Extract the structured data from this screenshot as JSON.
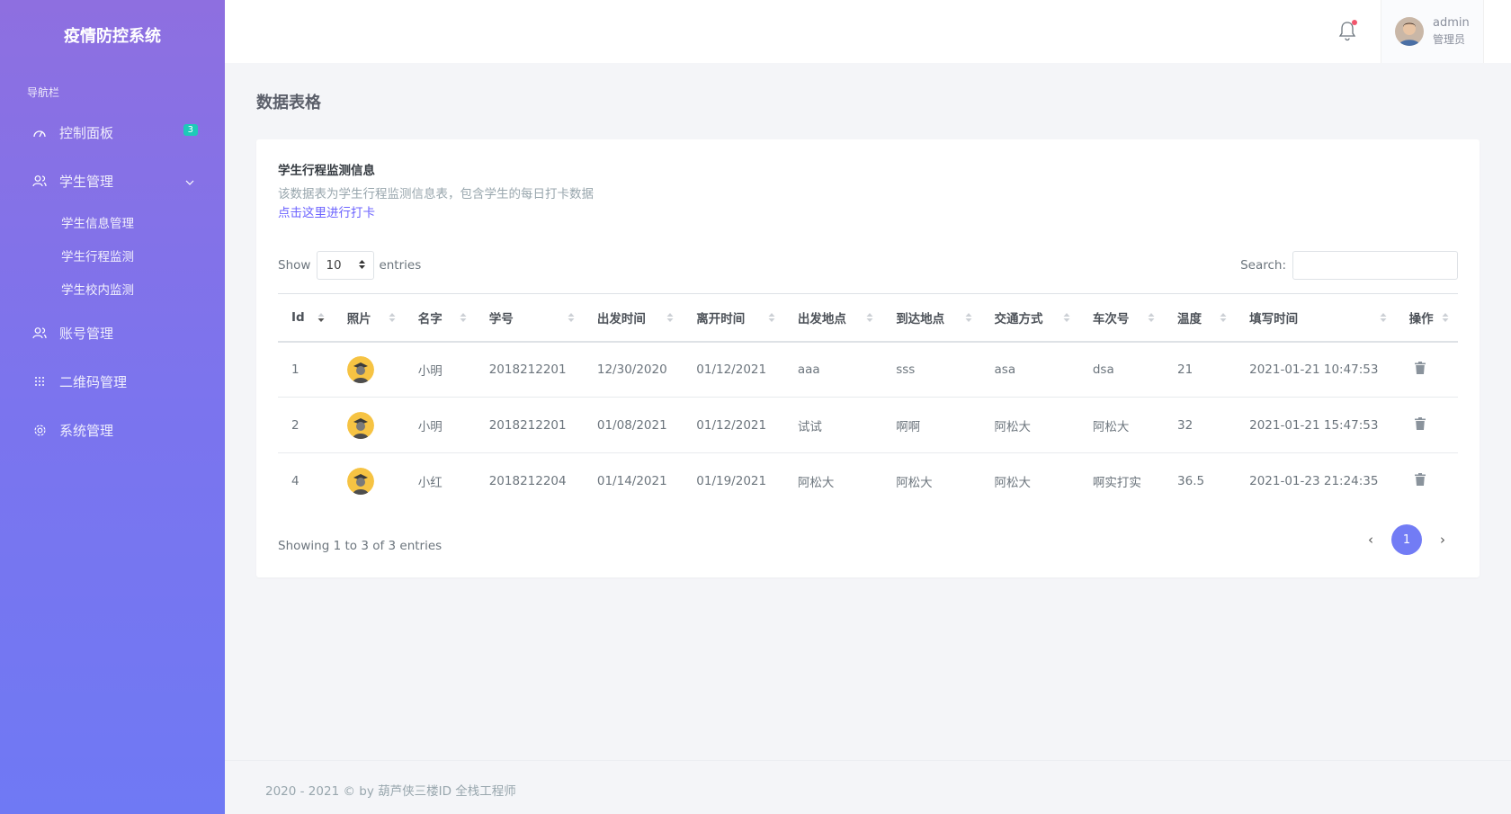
{
  "app": {
    "title": "疫情防控系统"
  },
  "sidebar": {
    "caption": "导航栏",
    "dashboard": {
      "label": "控制面板",
      "badge": "3",
      "icon": "dashboard-gauge-icon"
    },
    "student_mgmt": {
      "label": "学生管理",
      "icon": "users-icon",
      "children": [
        {
          "label": "学生信息管理"
        },
        {
          "label": "学生行程监测"
        },
        {
          "label": "学生校内监测"
        }
      ]
    },
    "account_mgmt": {
      "label": "账号管理",
      "icon": "users-icon"
    },
    "qrcode_mgmt": {
      "label": "二维码管理",
      "icon": "grid-icon"
    },
    "system_mgmt": {
      "label": "系统管理",
      "icon": "gear-icon"
    }
  },
  "topbar": {
    "user": {
      "name": "admin",
      "role": "管理员"
    }
  },
  "page": {
    "title": "数据表格"
  },
  "card": {
    "title": "学生行程监测信息",
    "description": "该数据表为学生行程监测信息表，包含学生的每日打卡数据",
    "link": "点击这里进行打卡"
  },
  "table_controls": {
    "show_label": "Show",
    "entries_label": "entries",
    "page_length": "10",
    "search_label": "Search:",
    "search_value": ""
  },
  "table": {
    "columns": [
      "Id",
      "照片",
      "名字",
      "学号",
      "出发时间",
      "离开时间",
      "出发地点",
      "到达地点",
      "交通方式",
      "车次号",
      "温度",
      "填写时间",
      "操作"
    ],
    "rows": [
      {
        "id": "1",
        "name": "小明",
        "student_no": "2018212201",
        "depart_time": "12/30/2020",
        "leave_time": "01/12/2021",
        "depart_place": "aaa",
        "arrive_place": "sss",
        "transport": "asa",
        "train_no": "dsa",
        "temperature": "21",
        "filled_at": "2021-01-21 10:47:53"
      },
      {
        "id": "2",
        "name": "小明",
        "student_no": "2018212201",
        "depart_time": "01/08/2021",
        "leave_time": "01/12/2021",
        "depart_place": "试试",
        "arrive_place": "啊啊",
        "transport": "阿松大",
        "train_no": "阿松大",
        "temperature": "32",
        "filled_at": "2021-01-21 15:47:53"
      },
      {
        "id": "4",
        "name": "小红",
        "student_no": "2018212204",
        "depart_time": "01/14/2021",
        "leave_time": "01/19/2021",
        "depart_place": "阿松大",
        "arrive_place": "阿松大",
        "transport": "阿松大",
        "train_no": "啊实打实",
        "temperature": "36.5",
        "filled_at": "2021-01-23 21:24:35"
      }
    ]
  },
  "pagination": {
    "info": "Showing 1 to 3 of 3 entries",
    "prev": "‹",
    "current": "1",
    "next": "›"
  },
  "footer": {
    "text": "2020 - 2021 © by 葫芦侠三楼ID 全栈工程师"
  },
  "colors": {
    "primary": "#727cf5",
    "badge": "#1ecab8",
    "notification_dot": "#f1556c"
  }
}
